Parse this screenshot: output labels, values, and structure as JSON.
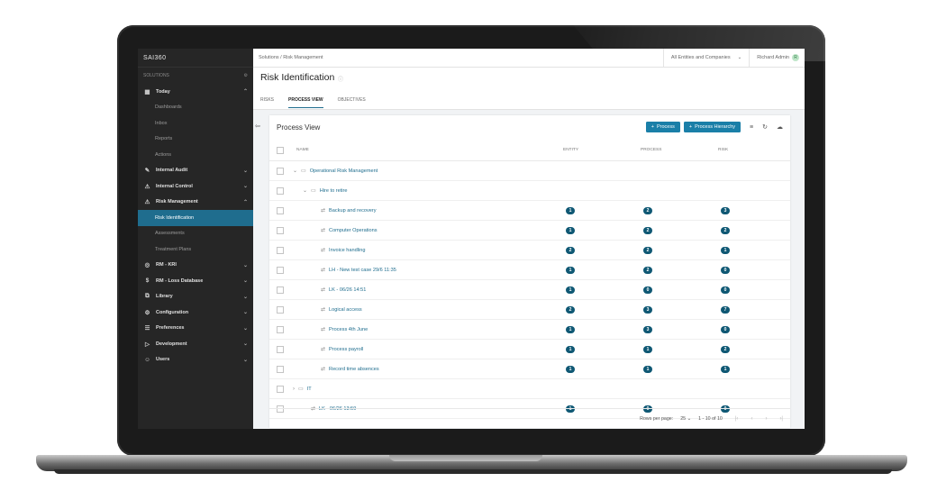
{
  "sidebar": {
    "logo": "SAI360",
    "solutions_label": "SOLUTIONS",
    "items": [
      {
        "icon": "calendar-icon",
        "label": "Today",
        "chev": "^",
        "subs": [
          "Dashboards",
          "Inbox",
          "Reports",
          "Actions"
        ]
      },
      {
        "icon": "pen-icon",
        "label": "Internal Audit",
        "chev": "v"
      },
      {
        "icon": "warning-icon",
        "label": "Internal Control",
        "chev": "v"
      },
      {
        "icon": "warning-icon",
        "label": "Risk Management",
        "chev": "^",
        "subs": [
          "Risk Identification",
          "Assessments",
          "Treatment Plans"
        ]
      },
      {
        "icon": "target-icon",
        "label": "RM - KRI",
        "chev": "v"
      },
      {
        "icon": "dollar-icon",
        "label": "RM - Loss Database",
        "chev": "v"
      },
      {
        "icon": "library-icon",
        "label": "Library",
        "chev": "v"
      },
      {
        "icon": "gear-icon",
        "label": "Configuration",
        "chev": "v"
      },
      {
        "icon": "sliders-icon",
        "label": "Preferences",
        "chev": "v"
      },
      {
        "icon": "code-icon",
        "label": "Development",
        "chev": "v"
      },
      {
        "icon": "user-icon",
        "label": "Users",
        "chev": "v"
      }
    ],
    "active_sub": "Risk Identification"
  },
  "topbar": {
    "breadcrumb": "Solutions  /  Risk Management",
    "entity_select": "All Entities and Companies",
    "user_name": "Richard Admin",
    "user_initial": "R"
  },
  "page": {
    "title": "Risk Identification",
    "tabs": [
      "RISKS",
      "PROCESS VIEW",
      "OBJECTIVES"
    ],
    "active_tab": "PROCESS VIEW"
  },
  "card": {
    "title": "Process View",
    "btn_process": "Process",
    "btn_hierarchy": "Process Hierarchy",
    "columns": {
      "name": "NAME",
      "entity": "ENTITY",
      "process": "PROCESS",
      "risk": "RISK"
    }
  },
  "rows": [
    {
      "type": "folder",
      "level": 0,
      "expanded": true,
      "name": "Operational Risk Management"
    },
    {
      "type": "folder",
      "level": 1,
      "expanded": true,
      "name": "Hire to retire"
    },
    {
      "type": "process",
      "level": 2,
      "name": "Backup and recovery",
      "entity": "1",
      "process": "2",
      "risk": "3"
    },
    {
      "type": "process",
      "level": 2,
      "name": "Computer Operations",
      "entity": "1",
      "process": "2",
      "risk": "2"
    },
    {
      "type": "process",
      "level": 2,
      "name": "Invoice handling",
      "entity": "2",
      "process": "2",
      "risk": "1"
    },
    {
      "type": "process",
      "level": 2,
      "name": "LH - New test case 29/6 11:35",
      "entity": "1",
      "process": "2",
      "risk": "0"
    },
    {
      "type": "process",
      "level": 2,
      "name": "LK - 06/26 14:51",
      "entity": "1",
      "process": "0",
      "risk": "0"
    },
    {
      "type": "process",
      "level": 2,
      "name": "Logical access",
      "entity": "2",
      "process": "3",
      "risk": "7"
    },
    {
      "type": "process",
      "level": 2,
      "name": "Process 4th June",
      "entity": "1",
      "process": "3",
      "risk": "0"
    },
    {
      "type": "process",
      "level": 2,
      "name": "Process payroll",
      "entity": "1",
      "process": "1",
      "risk": "2"
    },
    {
      "type": "process",
      "level": 2,
      "name": "Record time absences",
      "entity": "1",
      "process": "1",
      "risk": "1"
    },
    {
      "type": "folder",
      "level": 0,
      "expanded": false,
      "name": "IT"
    },
    {
      "type": "process",
      "level": 0,
      "name": "LK - 06/26 13:59",
      "entity": "1",
      "process": "0",
      "risk": "0"
    }
  ],
  "footer": {
    "rows_per_page_label": "Rows per page:",
    "rows_per_page": "25",
    "range": "1 - 10 of 10"
  },
  "colors": {
    "accent": "#1a7fa8",
    "badge": "#0f5874",
    "sidebar_bg": "#262626",
    "active": "#1f6d8e"
  }
}
